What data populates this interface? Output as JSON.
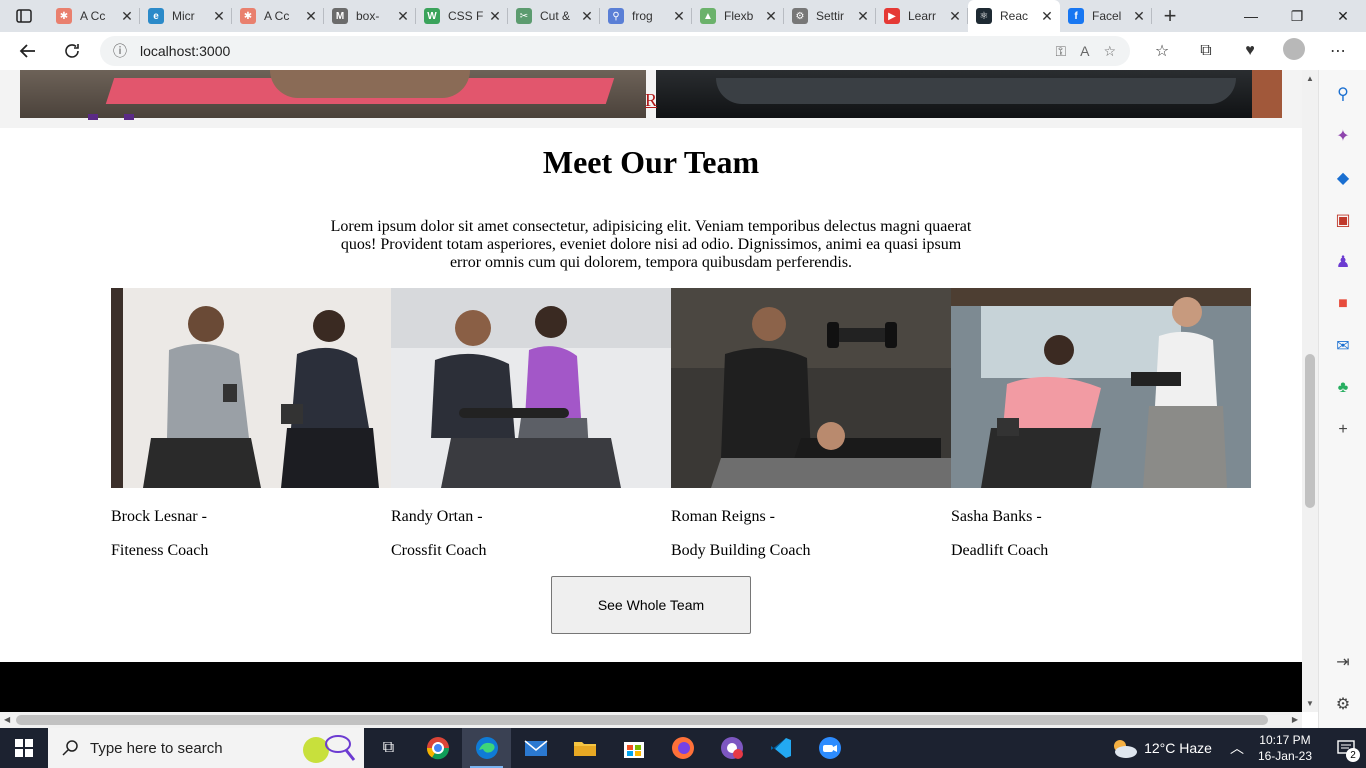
{
  "browser": {
    "tabs": [
      {
        "title": "A Cc",
        "fav_color": "#e9806e",
        "fav_glyph": "✱"
      },
      {
        "title": "Micr",
        "fav_color": "#2b8ac9",
        "fav_glyph": "e"
      },
      {
        "title": "A Cc",
        "fav_color": "#e9806e",
        "fav_glyph": "✱"
      },
      {
        "title": "box-",
        "fav_color": "#6b6b6b",
        "fav_glyph": "M"
      },
      {
        "title": "CSS F",
        "fav_color": "#3aa35b",
        "fav_glyph": "W"
      },
      {
        "title": "Cut &",
        "fav_color": "#5c9b6f",
        "fav_glyph": "✂"
      },
      {
        "title": "frog",
        "fav_color": "#5a7fd6",
        "fav_glyph": "⚲"
      },
      {
        "title": "Flexb",
        "fav_color": "#6bb26b",
        "fav_glyph": "▲"
      },
      {
        "title": "Settir",
        "fav_color": "#777777",
        "fav_glyph": "⚙"
      },
      {
        "title": "Learr",
        "fav_color": "#e53935",
        "fav_glyph": "▶"
      },
      {
        "title": "Reac",
        "fav_color": "#1e2a33",
        "fav_glyph": "⚛"
      },
      {
        "title": "Facel",
        "fav_color": "#1877f2",
        "fav_glyph": "f"
      }
    ],
    "active_tab_index": 10,
    "url": "localhost:3000"
  },
  "page": {
    "hero_link_text": "R",
    "team": {
      "title": "Meet Our Team",
      "description": "Lorem ipsum dolor sit amet consectetur, adipisicing elit. Veniam temporibus delectus magni quaerat quos! Provident totam asperiores, eveniet dolore nisi ad odio. Dignissimos, animi ea quasi ipsum error omnis cum qui dolorem, tempora quibusdam perferendis.",
      "members": [
        {
          "name": "Brock Lesnar -",
          "role": "Fiteness Coach"
        },
        {
          "name": "Randy Ortan -",
          "role": "Crossfit Coach"
        },
        {
          "name": "Roman Reigns -",
          "role": "Body Building Coach"
        },
        {
          "name": "Sasha Banks -",
          "role": "Deadlift Coach"
        }
      ],
      "button_label": "See Whole Team"
    }
  },
  "taskbar": {
    "search_placeholder": "Type here to search",
    "weather": "12°C  Haze",
    "time": "10:17 PM",
    "date": "16-Jan-23",
    "notifications": "2"
  }
}
